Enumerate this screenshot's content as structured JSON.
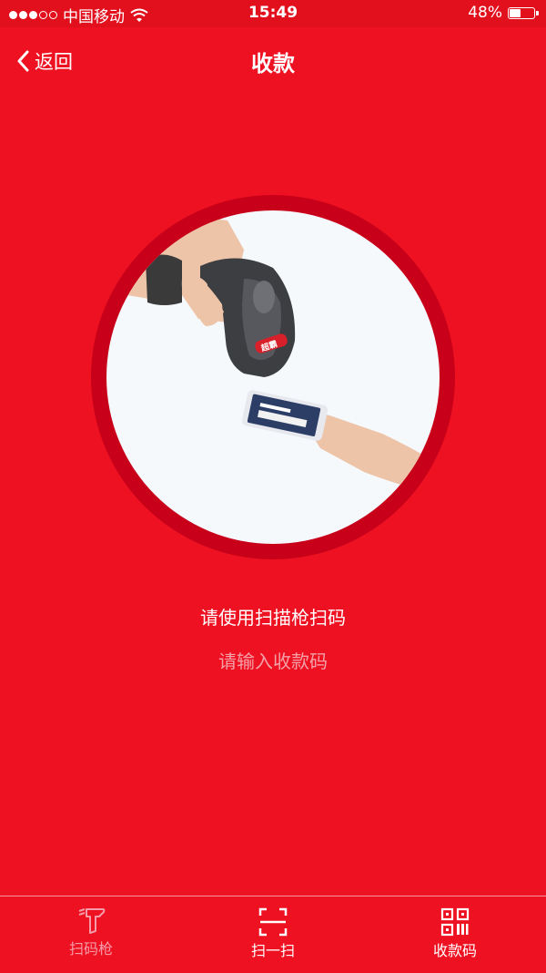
{
  "status_bar": {
    "carrier": "中国移动",
    "time": "15:49",
    "battery": "48%",
    "battery_level": 0.48
  },
  "nav": {
    "back_label": "返回",
    "title": "收款"
  },
  "illustration": {
    "scanner_brand": "超霸"
  },
  "main": {
    "prompt": "请使用扫描枪扫码",
    "input_hint": "请输入收款码"
  },
  "tab_bar": {
    "tabs": [
      {
        "label": "扫码枪",
        "icon": "barcode-scanner-icon",
        "active": false
      },
      {
        "label": "扫一扫",
        "icon": "scan-frame-icon",
        "active": true
      },
      {
        "label": "收款码",
        "icon": "qr-code-icon",
        "active": true
      }
    ]
  },
  "colors": {
    "background": "#ee1122",
    "ring": "#c8001a",
    "circle_fill": "#f5f9fc",
    "inactive_tab": "#f59aa8"
  }
}
